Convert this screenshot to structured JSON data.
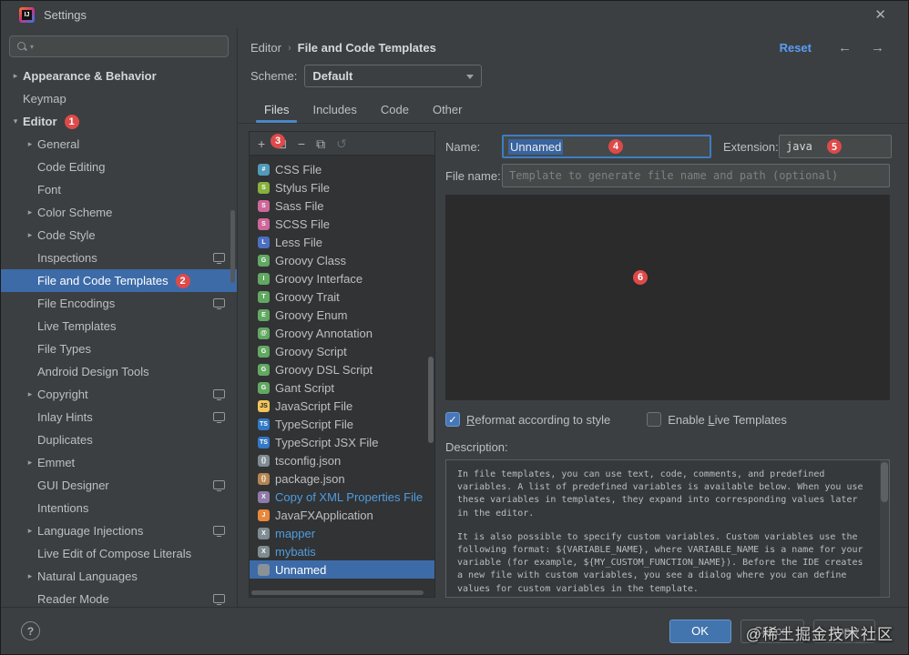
{
  "colors": {
    "accent": "#3d6ba8",
    "badge": "#dd4a4a",
    "link": "#589df6",
    "modified": "#4f9ddf"
  },
  "window": {
    "title": "Settings",
    "close_glyph": "✕"
  },
  "sidebar": {
    "search": {
      "placeholder": ""
    },
    "items": [
      {
        "label": "Appearance & Behavior",
        "indent": 0,
        "chevron": "collapsed",
        "bold": true
      },
      {
        "label": "Keymap",
        "indent": 0
      },
      {
        "label": "Editor",
        "indent": 0,
        "chevron": "expanded",
        "bold": true,
        "badge": "1"
      },
      {
        "label": "General",
        "indent": 1,
        "chevron": "collapsed"
      },
      {
        "label": "Code Editing",
        "indent": 1
      },
      {
        "label": "Font",
        "indent": 1
      },
      {
        "label": "Color Scheme",
        "indent": 1,
        "chevron": "collapsed"
      },
      {
        "label": "Code Style",
        "indent": 1,
        "chevron": "collapsed"
      },
      {
        "label": "Inspections",
        "indent": 1,
        "trailing_icon": true
      },
      {
        "label": "File and Code Templates",
        "indent": 1,
        "selected": true,
        "badge": "2"
      },
      {
        "label": "File Encodings",
        "indent": 1,
        "trailing_icon": true
      },
      {
        "label": "Live Templates",
        "indent": 1
      },
      {
        "label": "File Types",
        "indent": 1
      },
      {
        "label": "Android Design Tools",
        "indent": 1
      },
      {
        "label": "Copyright",
        "indent": 1,
        "chevron": "collapsed",
        "trailing_icon": true
      },
      {
        "label": "Inlay Hints",
        "indent": 1,
        "trailing_icon": true
      },
      {
        "label": "Duplicates",
        "indent": 1
      },
      {
        "label": "Emmet",
        "indent": 1,
        "chevron": "collapsed"
      },
      {
        "label": "GUI Designer",
        "indent": 1,
        "trailing_icon": true
      },
      {
        "label": "Intentions",
        "indent": 1
      },
      {
        "label": "Language Injections",
        "indent": 1,
        "chevron": "collapsed",
        "trailing_icon": true
      },
      {
        "label": "Live Edit of Compose Literals",
        "indent": 1
      },
      {
        "label": "Natural Languages",
        "indent": 1,
        "chevron": "collapsed"
      },
      {
        "label": "Reader Mode",
        "indent": 1,
        "trailing_icon": true
      }
    ]
  },
  "header": {
    "breadcrumb": [
      "Editor",
      "File and Code Templates"
    ],
    "separator": "›",
    "reset": "Reset",
    "back_glyph": "←",
    "forward_glyph": "→"
  },
  "scheme": {
    "label": "Scheme:",
    "value": "Default"
  },
  "tabs": [
    {
      "label": "Files",
      "selected": true
    },
    {
      "label": "Includes"
    },
    {
      "label": "Code"
    },
    {
      "label": "Other"
    }
  ],
  "templates_toolbar": {
    "badge": "3",
    "buttons": [
      {
        "name": "create-template",
        "glyph": "+"
      },
      {
        "name": "create-child-template",
        "glyph": "⊞"
      },
      {
        "name": "remove-template",
        "glyph": "−"
      },
      {
        "name": "copy-template",
        "glyph": "⧉"
      },
      {
        "name": "reset-to-default",
        "glyph": "↺",
        "disabled": true
      }
    ]
  },
  "templates": [
    {
      "label": "CSS File",
      "icon_color": "#519aba",
      "icon_text": "#"
    },
    {
      "label": "Stylus File",
      "icon_color": "#87b13c",
      "icon_text": "S"
    },
    {
      "label": "Sass File",
      "icon_color": "#cd6799",
      "icon_text": "S"
    },
    {
      "label": "SCSS File",
      "icon_color": "#cd6799",
      "icon_text": "S"
    },
    {
      "label": "Less File",
      "icon_color": "#4c6ec3",
      "icon_text": "L"
    },
    {
      "label": "Groovy Class",
      "icon_color": "#62a862",
      "icon_text": "G"
    },
    {
      "label": "Groovy Interface",
      "icon_color": "#62a862",
      "icon_text": "I"
    },
    {
      "label": "Groovy Trait",
      "icon_color": "#62a862",
      "icon_text": "T"
    },
    {
      "label": "Groovy Enum",
      "icon_color": "#62a862",
      "icon_text": "E"
    },
    {
      "label": "Groovy Annotation",
      "icon_color": "#62a862",
      "icon_text": "@"
    },
    {
      "label": "Groovy Script",
      "icon_color": "#62a862",
      "icon_text": "G"
    },
    {
      "label": "Groovy DSL Script",
      "icon_color": "#62a862",
      "icon_text": "G"
    },
    {
      "label": "Gant Script",
      "icon_color": "#62a862",
      "icon_text": "G"
    },
    {
      "label": "JavaScript File",
      "icon_color": "#f2c55c",
      "icon_text": "JS",
      "icon_text_dark": true
    },
    {
      "label": "TypeScript File",
      "icon_color": "#3178c6",
      "icon_text": "TS"
    },
    {
      "label": "TypeScript JSX File",
      "icon_color": "#3178c6",
      "icon_text": "TS"
    },
    {
      "label": "tsconfig.json",
      "icon_color": "#7f8b91",
      "icon_text": "{}"
    },
    {
      "label": "package.json",
      "icon_color": "#b5854f",
      "icon_text": "{}"
    },
    {
      "label": "Copy of XML Properties File",
      "icon_color": "#8f7ba8",
      "icon_text": "X",
      "modified": true
    },
    {
      "label": "JavaFXApplication",
      "icon_color": "#e8883a",
      "icon_text": "J"
    },
    {
      "label": "mapper",
      "icon_color": "#7f8b91",
      "icon_text": "X",
      "modified": true
    },
    {
      "label": "mybatis",
      "icon_color": "#7f8b91",
      "icon_text": "X",
      "modified": true
    },
    {
      "label": "Unnamed",
      "icon_color": "#8a9199",
      "icon_text": "",
      "selected": true
    }
  ],
  "name_field": {
    "label": "Name:",
    "value": "Unnamed",
    "badge": "4"
  },
  "extension_field": {
    "label": "Extension:",
    "value": "java",
    "badge": "5"
  },
  "file_name_field": {
    "label": "File name:",
    "placeholder": "Template to generate file name and path (optional)"
  },
  "editor": {
    "badge": "6"
  },
  "options": [
    {
      "label": "Reformat according to style",
      "checked": true,
      "underline_index": 0
    },
    {
      "label": "Enable Live Templates",
      "checked": false,
      "underline_index": 7
    }
  ],
  "description": {
    "label": "Description:",
    "paragraphs": [
      "In file templates, you can use text, code, comments, and predefined variables. A list of predefined variables is available below. When you use these variables in templates, they expand into corresponding values later in the editor.",
      "It is also possible to specify custom variables. Custom variables use the following format: ${VARIABLE_NAME}, where VARIABLE_NAME is a name for your variable (for example, ${MY_CUSTOM_FUNCTION_NAME}). Before the IDE creates a new file with custom variables, you see a dialog where you can define values for custom variables in the template."
    ]
  },
  "footer": {
    "help_glyph": "?",
    "buttons": [
      {
        "label": "OK",
        "primary": true
      },
      {
        "label": "Cancel"
      },
      {
        "label": "Apply"
      }
    ],
    "watermark": "@稀土掘金技术社区"
  }
}
